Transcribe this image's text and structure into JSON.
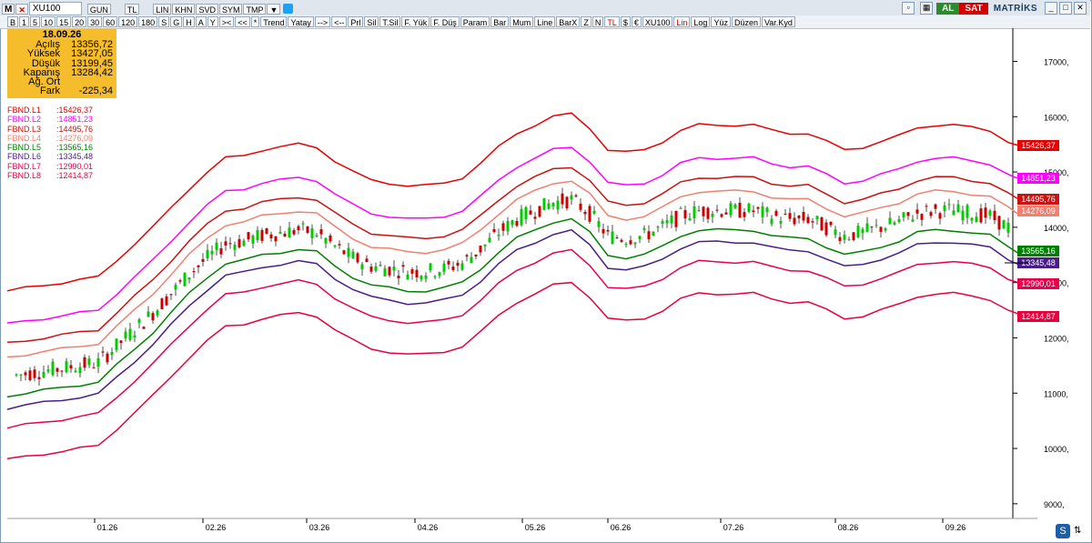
{
  "toolbar": {
    "menu_letter": "M",
    "ticker": "XU100",
    "row1_buttons": [
      "GUN",
      "TL",
      "LIN",
      "KHN",
      "SVD",
      "SYM",
      "TMP"
    ],
    "right": {
      "al": "AL",
      "sat": "SAT",
      "brand": "MATRİKS"
    },
    "row2_buttons": [
      "B",
      "1",
      "5",
      "10",
      "15",
      "20",
      "30",
      "60",
      "120",
      "180",
      "S",
      "G",
      "H",
      "A",
      "Y",
      "><",
      "<<",
      "*",
      "Trend",
      "Yatay",
      "-->",
      "<--",
      "Prl",
      "Sil",
      "T.Sil",
      "F. Yük",
      "F. Düş",
      "Param",
      "Bar",
      "Mum",
      "Line",
      "BarX",
      "Z",
      "N",
      "TL",
      "$",
      "€",
      "XU100",
      "Lin",
      "Log",
      "Yüz",
      "Düzen",
      "Var.Kyd"
    ]
  },
  "info": {
    "date": "18.09.26",
    "rows": [
      {
        "label": "Açılış",
        "value": "13356,72"
      },
      {
        "label": "Yüksek",
        "value": "13427,05"
      },
      {
        "label": "Düşük",
        "value": "13199,45"
      },
      {
        "label": "Kapanış",
        "value": "13284,42"
      },
      {
        "label": "Ağ. Ort",
        "value": ""
      },
      {
        "label": "Fark",
        "value": "-225,34"
      }
    ]
  },
  "colors": {
    "L1": "#e60000",
    "L2": "#ff00ff",
    "L3": "#cc1111",
    "L4": "#f08070",
    "L5": "#008000",
    "L6": "#4b1c8c",
    "L7": "#e8004c",
    "L8": "#e8003c",
    "up": "#00cc00",
    "down": "#cc0000"
  },
  "chart_data": {
    "type": "line",
    "title": "",
    "symbol": "XU100",
    "x_ticks": [
      "01.26",
      "02.26",
      "03.26",
      "04.26",
      "05.26",
      "06.26",
      "07.26",
      "08.26",
      "09.26"
    ],
    "y_ticks": [
      "17000,",
      "16000,",
      "15000,",
      "14000,",
      "13000,",
      "12000,",
      "11000,",
      "10000,",
      "9000,"
    ],
    "ylim": [
      8800,
      17600
    ],
    "series": [
      {
        "name": "FBND.L1",
        "last": "15426,37"
      },
      {
        "name": "FBND.L2",
        "last": "14851,23"
      },
      {
        "name": "FBND.L3",
        "last": "14495,76"
      },
      {
        "name": "FBND.L4",
        "last": "14276,09"
      },
      {
        "name": "FBND.L5",
        "last": "13565,16"
      },
      {
        "name": "FBND.L6",
        "last": "13345,48"
      },
      {
        "name": "FBND.L7",
        "last": "12990,01"
      },
      {
        "name": "FBND.L8",
        "last": "12414,87"
      }
    ],
    "legend_values": [
      ":15426,37",
      ":14851,23",
      ":14495,76",
      ":14276,09",
      ":13565,16",
      ":13345,48",
      ":12990,01",
      ":12414,87"
    ],
    "mid_series_x": [
      0,
      20,
      40,
      60,
      80,
      100,
      120,
      140,
      160,
      180,
      200,
      220,
      240,
      260,
      280,
      300,
      320,
      340,
      360,
      380,
      400,
      420,
      440,
      460,
      480,
      500,
      520,
      540,
      560,
      580,
      600,
      620,
      640,
      660,
      680,
      700,
      720,
      740,
      760,
      780,
      800,
      820,
      840,
      860,
      880,
      900,
      920,
      940,
      960,
      980,
      1000,
      1020,
      1040,
      1060,
      1080,
      1100,
      1110
    ],
    "mid_series": [
      10950,
      11000,
      11050,
      11100,
      11150,
      11200,
      11500,
      11800,
      12100,
      12450,
      12800,
      13100,
      13350,
      13400,
      13500,
      13550,
      13600,
      13550,
      13300,
      13100,
      12950,
      12900,
      12850,
      12850,
      12900,
      13000,
      13250,
      13550,
      13800,
      13950,
      14100,
      14150,
      13900,
      13500,
      13450,
      13500,
      13650,
      13850,
      13950,
      13950,
      13950,
      13950,
      13850,
      13800,
      13800,
      13650,
      13500,
      13550,
      13650,
      13750,
      13900,
      13950,
      13950,
      13900,
      13850,
      13650,
      13565
    ]
  },
  "price_label": "13284,42"
}
